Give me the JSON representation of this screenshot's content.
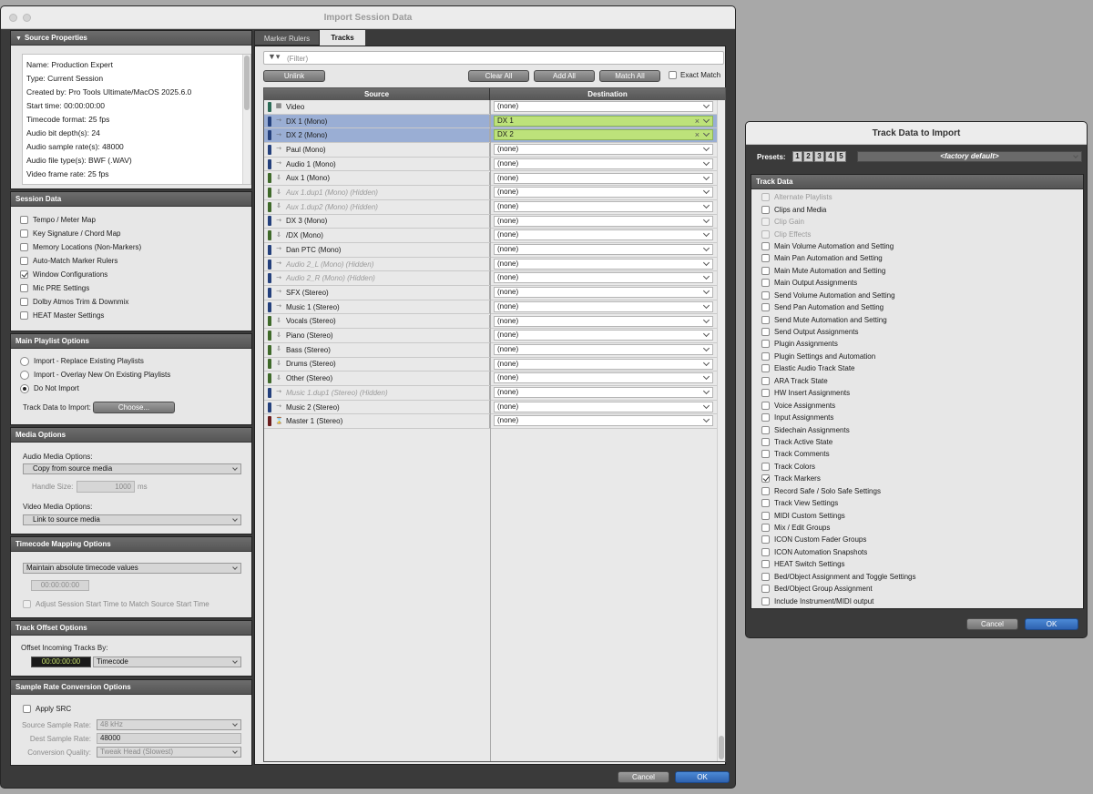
{
  "main_window": {
    "title": "Import Session Data"
  },
  "source_properties": {
    "header": "Source Properties",
    "lines": [
      "Name: Production Expert",
      "Type: Current Session",
      "Created by: Pro Tools Ultimate/MacOS 2025.6.0",
      "Start time: 00:00:00:00",
      "Timecode format: 25 fps",
      "Audio bit depth(s): 24",
      "Audio sample rate(s): 48000",
      "Audio file type(s): BWF (.WAV)",
      "Video frame rate: 25 fps"
    ]
  },
  "session_data": {
    "header": "Session Data",
    "items": [
      {
        "label": "Tempo / Meter Map",
        "checked": false
      },
      {
        "label": "Key Signature / Chord Map",
        "checked": false
      },
      {
        "label": "Memory Locations (Non-Markers)",
        "checked": false
      },
      {
        "label": "Auto-Match Marker Rulers",
        "checked": false
      },
      {
        "label": "Window Configurations",
        "checked": true
      },
      {
        "label": "Mic PRE Settings",
        "checked": false
      },
      {
        "label": "Dolby Atmos Trim & Downmix",
        "checked": false
      },
      {
        "label": "HEAT Master Settings",
        "checked": false
      }
    ]
  },
  "main_playlist": {
    "header": "Main Playlist Options",
    "options": [
      {
        "label": "Import - Replace Existing Playlists",
        "selected": false
      },
      {
        "label": "Import - Overlay New On Existing Playlists",
        "selected": false
      },
      {
        "label": "Do Not Import",
        "selected": true
      }
    ],
    "track_data_label": "Track Data to Import:",
    "choose_label": "Choose..."
  },
  "media_options": {
    "header": "Media Options",
    "audio_label": "Audio Media Options:",
    "audio_value": "Copy from source media",
    "handle_label": "Handle Size:",
    "handle_value": "1000",
    "handle_unit": "ms",
    "video_label": "Video Media Options:",
    "video_value": "Link to source media"
  },
  "timecode_mapping": {
    "header": "Timecode Mapping Options",
    "value": "Maintain absolute timecode values",
    "timecode": "00:00:00:00",
    "adjust_label": "Adjust Session Start Time to Match Source Start Time"
  },
  "track_offset": {
    "header": "Track Offset Options",
    "label": "Offset Incoming Tracks By:",
    "timecode": "00:00:00:00",
    "unit": "Timecode"
  },
  "src": {
    "header": "Sample Rate Conversion Options",
    "apply_label": "Apply SRC",
    "source_label": "Source Sample Rate:",
    "source_value": "48 kHz",
    "dest_label": "Dest Sample Rate:",
    "dest_value": "48000",
    "quality_label": "Conversion Quality:",
    "quality_value": "Tweak Head (Slowest)"
  },
  "tabs": [
    {
      "label": "Marker Rulers",
      "active": false
    },
    {
      "label": "Tracks",
      "active": true
    }
  ],
  "filter_placeholder": "(Filter)",
  "buttons": {
    "unlink": "Unlink",
    "clear_all": "Clear All",
    "add_all": "Add All",
    "match_all": "Match All",
    "exact_match": "Exact Match",
    "cancel": "Cancel",
    "ok": "OK"
  },
  "table": {
    "source_header": "Source",
    "dest_header": "Destination",
    "rows": [
      {
        "name": "Video",
        "color": "#2c6b56",
        "icon": "video-icon",
        "dest": "(none)",
        "hidden": false,
        "selected": false,
        "assigned": false
      },
      {
        "name": "DX 1 (Mono)",
        "color": "#24407c",
        "icon": "audio-icon",
        "dest": "DX 1",
        "hidden": false,
        "selected": true,
        "assigned": true
      },
      {
        "name": "DX 2 (Mono)",
        "color": "#24407c",
        "icon": "audio-icon",
        "dest": "DX 2",
        "hidden": false,
        "selected": true,
        "assigned": true
      },
      {
        "name": "Paul (Mono)",
        "color": "#24407c",
        "icon": "audio-icon",
        "dest": "(none)",
        "hidden": false,
        "selected": false,
        "assigned": false
      },
      {
        "name": "Audio 1 (Mono)",
        "color": "#24407c",
        "icon": "audio-icon",
        "dest": "(none)",
        "hidden": false,
        "selected": false,
        "assigned": false
      },
      {
        "name": "Aux 1 (Mono)",
        "color": "#3f6a2a",
        "icon": "aux-icon",
        "dest": "(none)",
        "hidden": false,
        "selected": false,
        "assigned": false
      },
      {
        "name": "Aux 1.dup1 (Mono) (Hidden)",
        "color": "#3f6a2a",
        "icon": "aux-icon",
        "dest": "(none)",
        "hidden": true,
        "selected": false,
        "assigned": false
      },
      {
        "name": "Aux 1.dup2 (Mono) (Hidden)",
        "color": "#3f6a2a",
        "icon": "aux-icon",
        "dest": "(none)",
        "hidden": true,
        "selected": false,
        "assigned": false
      },
      {
        "name": "DX 3 (Mono)",
        "color": "#24407c",
        "icon": "audio-icon",
        "dest": "(none)",
        "hidden": false,
        "selected": false,
        "assigned": false
      },
      {
        "name": "/DX (Mono)",
        "color": "#3f6a2a",
        "icon": "aux-icon",
        "dest": "(none)",
        "hidden": false,
        "selected": false,
        "assigned": false
      },
      {
        "name": "Dan PTC (Mono)",
        "color": "#24407c",
        "icon": "audio-icon",
        "dest": "(none)",
        "hidden": false,
        "selected": false,
        "assigned": false
      },
      {
        "name": "Audio 2_L (Mono) (Hidden)",
        "color": "#24407c",
        "icon": "audio-icon",
        "dest": "(none)",
        "hidden": true,
        "selected": false,
        "assigned": false
      },
      {
        "name": "Audio 2_R (Mono) (Hidden)",
        "color": "#24407c",
        "icon": "audio-icon",
        "dest": "(none)",
        "hidden": true,
        "selected": false,
        "assigned": false
      },
      {
        "name": "SFX (Stereo)",
        "color": "#24407c",
        "icon": "audio-icon",
        "dest": "(none)",
        "hidden": false,
        "selected": false,
        "assigned": false
      },
      {
        "name": "Music 1 (Stereo)",
        "color": "#24407c",
        "icon": "audio-icon",
        "dest": "(none)",
        "hidden": false,
        "selected": false,
        "assigned": false
      },
      {
        "name": "Vocals (Stereo)",
        "color": "#3f6a2a",
        "icon": "aux-icon",
        "dest": "(none)",
        "hidden": false,
        "selected": false,
        "assigned": false
      },
      {
        "name": "Piano (Stereo)",
        "color": "#3f6a2a",
        "icon": "aux-icon",
        "dest": "(none)",
        "hidden": false,
        "selected": false,
        "assigned": false
      },
      {
        "name": "Bass (Stereo)",
        "color": "#3f6a2a",
        "icon": "aux-icon",
        "dest": "(none)",
        "hidden": false,
        "selected": false,
        "assigned": false
      },
      {
        "name": "Drums (Stereo)",
        "color": "#3f6a2a",
        "icon": "aux-icon",
        "dest": "(none)",
        "hidden": false,
        "selected": false,
        "assigned": false
      },
      {
        "name": "Other (Stereo)",
        "color": "#3f6a2a",
        "icon": "aux-icon",
        "dest": "(none)",
        "hidden": false,
        "selected": false,
        "assigned": false
      },
      {
        "name": "Music 1.dup1 (Stereo) (Hidden)",
        "color": "#24407c",
        "icon": "audio-icon",
        "dest": "(none)",
        "hidden": true,
        "selected": false,
        "assigned": false
      },
      {
        "name": "Music 2 (Stereo)",
        "color": "#24407c",
        "icon": "audio-icon",
        "dest": "(none)",
        "hidden": false,
        "selected": false,
        "assigned": false
      },
      {
        "name": "Master 1 (Stereo)",
        "color": "#6b1e1e",
        "icon": "master-icon",
        "dest": "(none)",
        "hidden": false,
        "selected": false,
        "assigned": false
      }
    ]
  },
  "track_data_window": {
    "title": "Track Data to Import",
    "presets_label": "Presets:",
    "preset_buttons": [
      "1",
      "2",
      "3",
      "4",
      "5"
    ],
    "preset_value": "<factory default>",
    "section_header": "Track Data",
    "items": [
      {
        "label": "Alternate Playlists",
        "checked": false,
        "disabled": true
      },
      {
        "label": "Clips and Media",
        "checked": false,
        "disabled": false
      },
      {
        "label": "Clip Gain",
        "checked": false,
        "disabled": true
      },
      {
        "label": "Clip Effects",
        "checked": false,
        "disabled": true
      },
      {
        "label": "Main Volume Automation and Setting",
        "checked": false,
        "disabled": false
      },
      {
        "label": "Main Pan Automation and Setting",
        "checked": false,
        "disabled": false
      },
      {
        "label": "Main Mute Automation and Setting",
        "checked": false,
        "disabled": false
      },
      {
        "label": "Main Output Assignments",
        "checked": false,
        "disabled": false
      },
      {
        "label": "Send Volume Automation and Setting",
        "checked": false,
        "disabled": false
      },
      {
        "label": "Send Pan Automation and Setting",
        "checked": false,
        "disabled": false
      },
      {
        "label": "Send Mute Automation and Setting",
        "checked": false,
        "disabled": false
      },
      {
        "label": "Send Output Assignments",
        "checked": false,
        "disabled": false
      },
      {
        "label": "Plugin Assignments",
        "checked": false,
        "disabled": false
      },
      {
        "label": "Plugin Settings and Automation",
        "checked": false,
        "disabled": false
      },
      {
        "label": "Elastic Audio Track State",
        "checked": false,
        "disabled": false
      },
      {
        "label": "ARA Track State",
        "checked": false,
        "disabled": false
      },
      {
        "label": "HW Insert Assignments",
        "checked": false,
        "disabled": false
      },
      {
        "label": "Voice Assignments",
        "checked": false,
        "disabled": false
      },
      {
        "label": "Input Assignments",
        "checked": false,
        "disabled": false
      },
      {
        "label": "Sidechain Assignments",
        "checked": false,
        "disabled": false
      },
      {
        "label": "Track Active State",
        "checked": false,
        "disabled": false
      },
      {
        "label": "Track Comments",
        "checked": false,
        "disabled": false
      },
      {
        "label": "Track Colors",
        "checked": false,
        "disabled": false
      },
      {
        "label": "Track Markers",
        "checked": true,
        "disabled": false
      },
      {
        "label": "Record Safe / Solo Safe Settings",
        "checked": false,
        "disabled": false
      },
      {
        "label": "Track View Settings",
        "checked": false,
        "disabled": false
      },
      {
        "label": "MIDI Custom Settings",
        "checked": false,
        "disabled": false
      },
      {
        "label": "Mix / Edit Groups",
        "checked": false,
        "disabled": false
      },
      {
        "label": "ICON Custom Fader Groups",
        "checked": false,
        "disabled": false
      },
      {
        "label": "ICON Automation Snapshots",
        "checked": false,
        "disabled": false
      },
      {
        "label": "HEAT Switch Settings",
        "checked": false,
        "disabled": false
      },
      {
        "label": "Bed/Object Assignment and Toggle Settings",
        "checked": false,
        "disabled": false
      },
      {
        "label": "Bed/Object Group Assignment",
        "checked": false,
        "disabled": false
      },
      {
        "label": "Include Instrument/MIDI output",
        "checked": false,
        "disabled": false
      }
    ],
    "cancel": "Cancel",
    "ok": "OK"
  }
}
